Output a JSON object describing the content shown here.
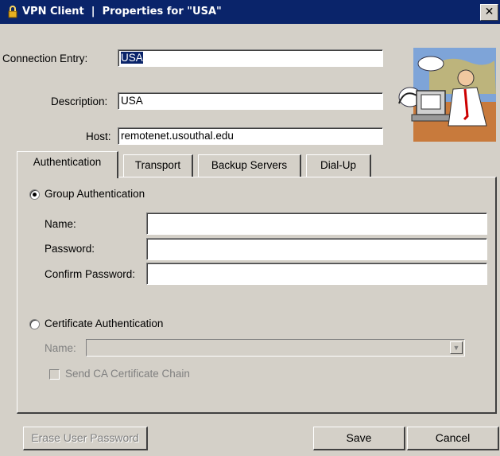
{
  "window": {
    "title": "VPN Client  |  Properties for \"USA\"",
    "close_glyph": "✕",
    "icon": "lock-icon"
  },
  "form": {
    "connection_entry_label": "Connection Entry:",
    "connection_entry_value": "USA",
    "description_label": "Description:",
    "description_value": "USA",
    "host_label": "Host:",
    "host_value": "remotenet.usouthal.edu"
  },
  "tabs": [
    {
      "label": "Authentication",
      "active": true
    },
    {
      "label": "Transport",
      "active": false
    },
    {
      "label": "Backup Servers",
      "active": false
    },
    {
      "label": "Dial-Up",
      "active": false
    }
  ],
  "auth": {
    "group_label": "Group Authentication",
    "group_selected": true,
    "name_label": "Name:",
    "name_value": "",
    "password_label": "Password:",
    "password_value": "",
    "confirm_label": "Confirm Password:",
    "confirm_value": "",
    "cert_label": "Certificate Authentication",
    "cert_selected": false,
    "cert_name_label": "Name:",
    "cert_name_value": "",
    "send_chain_label": "Send CA Certificate Chain",
    "send_chain_checked": false
  },
  "buttons": {
    "erase": "Erase User Password",
    "save": "Save",
    "cancel": "Cancel"
  },
  "colors": {
    "titlebar": "#0a246a",
    "dialog_bg": "#d4d0c8",
    "selection": "#0a246a"
  }
}
